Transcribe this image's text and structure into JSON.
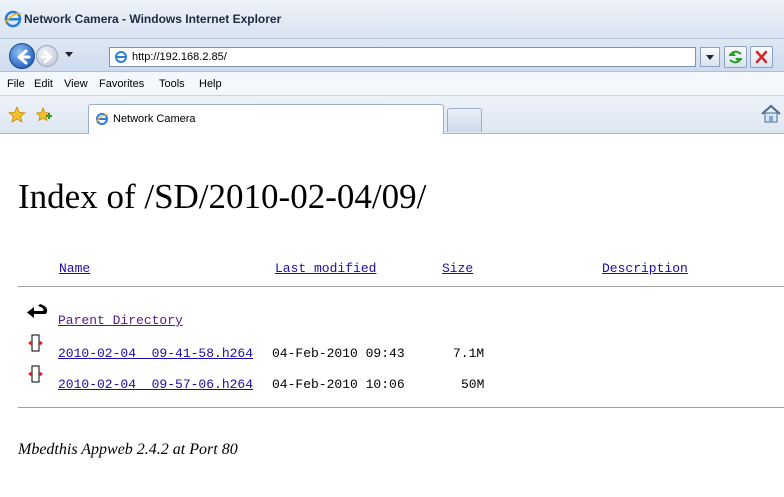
{
  "window": {
    "title": "Network Camera - Windows Internet Explorer"
  },
  "navbar": {
    "url": "http://192.168.2.85/"
  },
  "menu": [
    "File",
    "Edit",
    "View",
    "Favorites",
    "Tools",
    "Help"
  ],
  "tabs": {
    "active_label": "Network Camera"
  },
  "page": {
    "heading": "Index of /SD/2010-02-04/09/",
    "columns": {
      "name": "Name",
      "last_modified": "Last modified",
      "size": "Size",
      "description": "Description"
    },
    "parent_link": "Parent Directory",
    "files": [
      {
        "name": "2010-02-04__09-41-58.h264",
        "modified": "04-Feb-2010 09:43",
        "size": "7.1M"
      },
      {
        "name": "2010-02-04__09-57-06.h264",
        "modified": "04-Feb-2010 10:06",
        "size": "50M"
      }
    ],
    "footer": "Mbedthis Appweb 2.4.2 at Port 80"
  },
  "colors": {
    "link": "#1a0dab",
    "visited_link": "#551a8b",
    "title_bar": "#d9e3f1"
  }
}
